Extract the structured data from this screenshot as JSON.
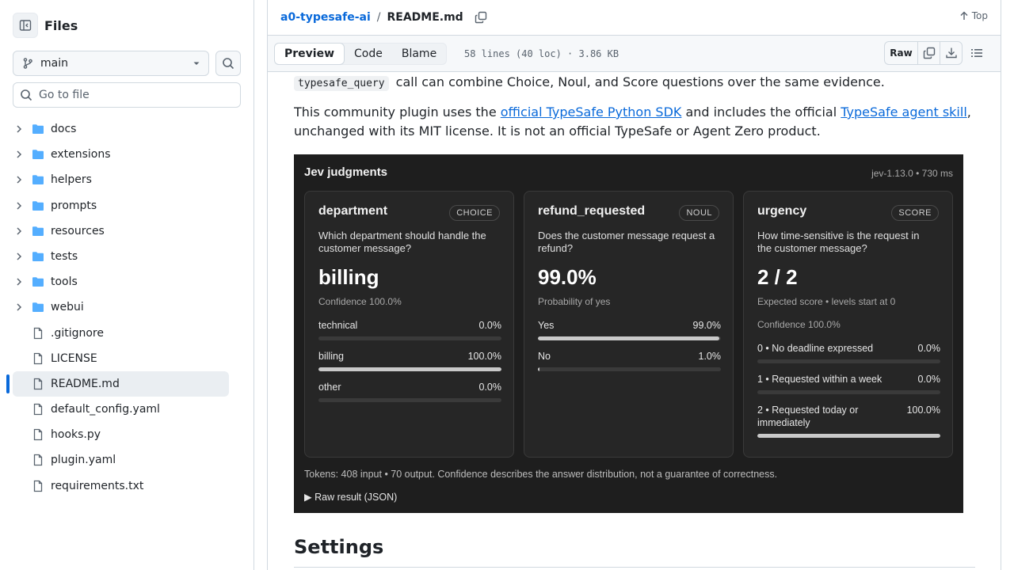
{
  "sidebar": {
    "title": "Files",
    "branch": "main",
    "goto_placeholder": "Go to file",
    "items": [
      {
        "name": "docs",
        "type": "folder"
      },
      {
        "name": "extensions",
        "type": "folder"
      },
      {
        "name": "helpers",
        "type": "folder"
      },
      {
        "name": "prompts",
        "type": "folder"
      },
      {
        "name": "resources",
        "type": "folder"
      },
      {
        "name": "tests",
        "type": "folder"
      },
      {
        "name": "tools",
        "type": "folder"
      },
      {
        "name": "webui",
        "type": "folder"
      },
      {
        "name": ".gitignore",
        "type": "file"
      },
      {
        "name": "LICENSE",
        "type": "file"
      },
      {
        "name": "README.md",
        "type": "file",
        "active": true
      },
      {
        "name": "default_config.yaml",
        "type": "file"
      },
      {
        "name": "hooks.py",
        "type": "file"
      },
      {
        "name": "plugin.yaml",
        "type": "file"
      },
      {
        "name": "requirements.txt",
        "type": "file"
      }
    ]
  },
  "header": {
    "repo": "a0-typesafe-ai",
    "separator": "/",
    "file": "README.md",
    "top_label": "Top"
  },
  "toolbar": {
    "tabs": [
      "Preview",
      "Code",
      "Blame"
    ],
    "active_tab": "Preview",
    "file_info": "58 lines (40 loc) · 3.86 KB",
    "raw_label": "Raw"
  },
  "readme": {
    "p1_code": "typesafe_query",
    "p1_text": "call can combine Choice, Noul, and Score questions over the same evidence.",
    "p2_pre": "This community plugin uses the",
    "p2_link1": "official TypeSafe Python SDK",
    "p2_mid": "and includes the official",
    "p2_link2": "TypeSafe agent skill",
    "p2_post": ", unchanged with its MIT license. It is not an official TypeSafe or Agent Zero product.",
    "heading": "Settings"
  },
  "jev": {
    "title": "Jev judgments",
    "version": "jev-1.13.0 • 730 ms",
    "cards": [
      {
        "name": "department",
        "badge": "CHOICE",
        "question": "Which department should handle the customer message?",
        "big": "billing",
        "subs": [
          "Confidence 100.0%"
        ],
        "options": [
          {
            "label": "technical",
            "value": "0.0%",
            "fraction": 0.0
          },
          {
            "label": "billing",
            "value": "100.0%",
            "fraction": 1.0
          },
          {
            "label": "other",
            "value": "0.0%",
            "fraction": 0.0
          }
        ]
      },
      {
        "name": "refund_requested",
        "badge": "NOUL",
        "question": "Does the customer message request a refund?",
        "big": "99.0%",
        "subs": [
          "Probability of yes"
        ],
        "options": [
          {
            "label": "Yes",
            "value": "99.0%",
            "fraction": 0.99
          },
          {
            "label": "No",
            "value": "1.0%",
            "fraction": 0.01
          }
        ]
      },
      {
        "name": "urgency",
        "badge": "SCORE",
        "question": "How time-sensitive is the request in the customer message?",
        "big": "2 / 2",
        "subs": [
          "Expected score • levels start at 0",
          "Confidence 100.0%"
        ],
        "options": [
          {
            "label": "0 • No deadline expressed",
            "value": "0.0%",
            "fraction": 0.0
          },
          {
            "label": "1 • Requested within a week",
            "value": "0.0%",
            "fraction": 0.0
          },
          {
            "label": "2 • Requested today or immediately",
            "value": "100.0%",
            "fraction": 1.0
          }
        ]
      }
    ],
    "footer": "Tokens: 408 input • 70 output. Confidence describes the answer distribution, not a guarantee of correctness.",
    "raw_result": "Raw result (JSON)"
  }
}
